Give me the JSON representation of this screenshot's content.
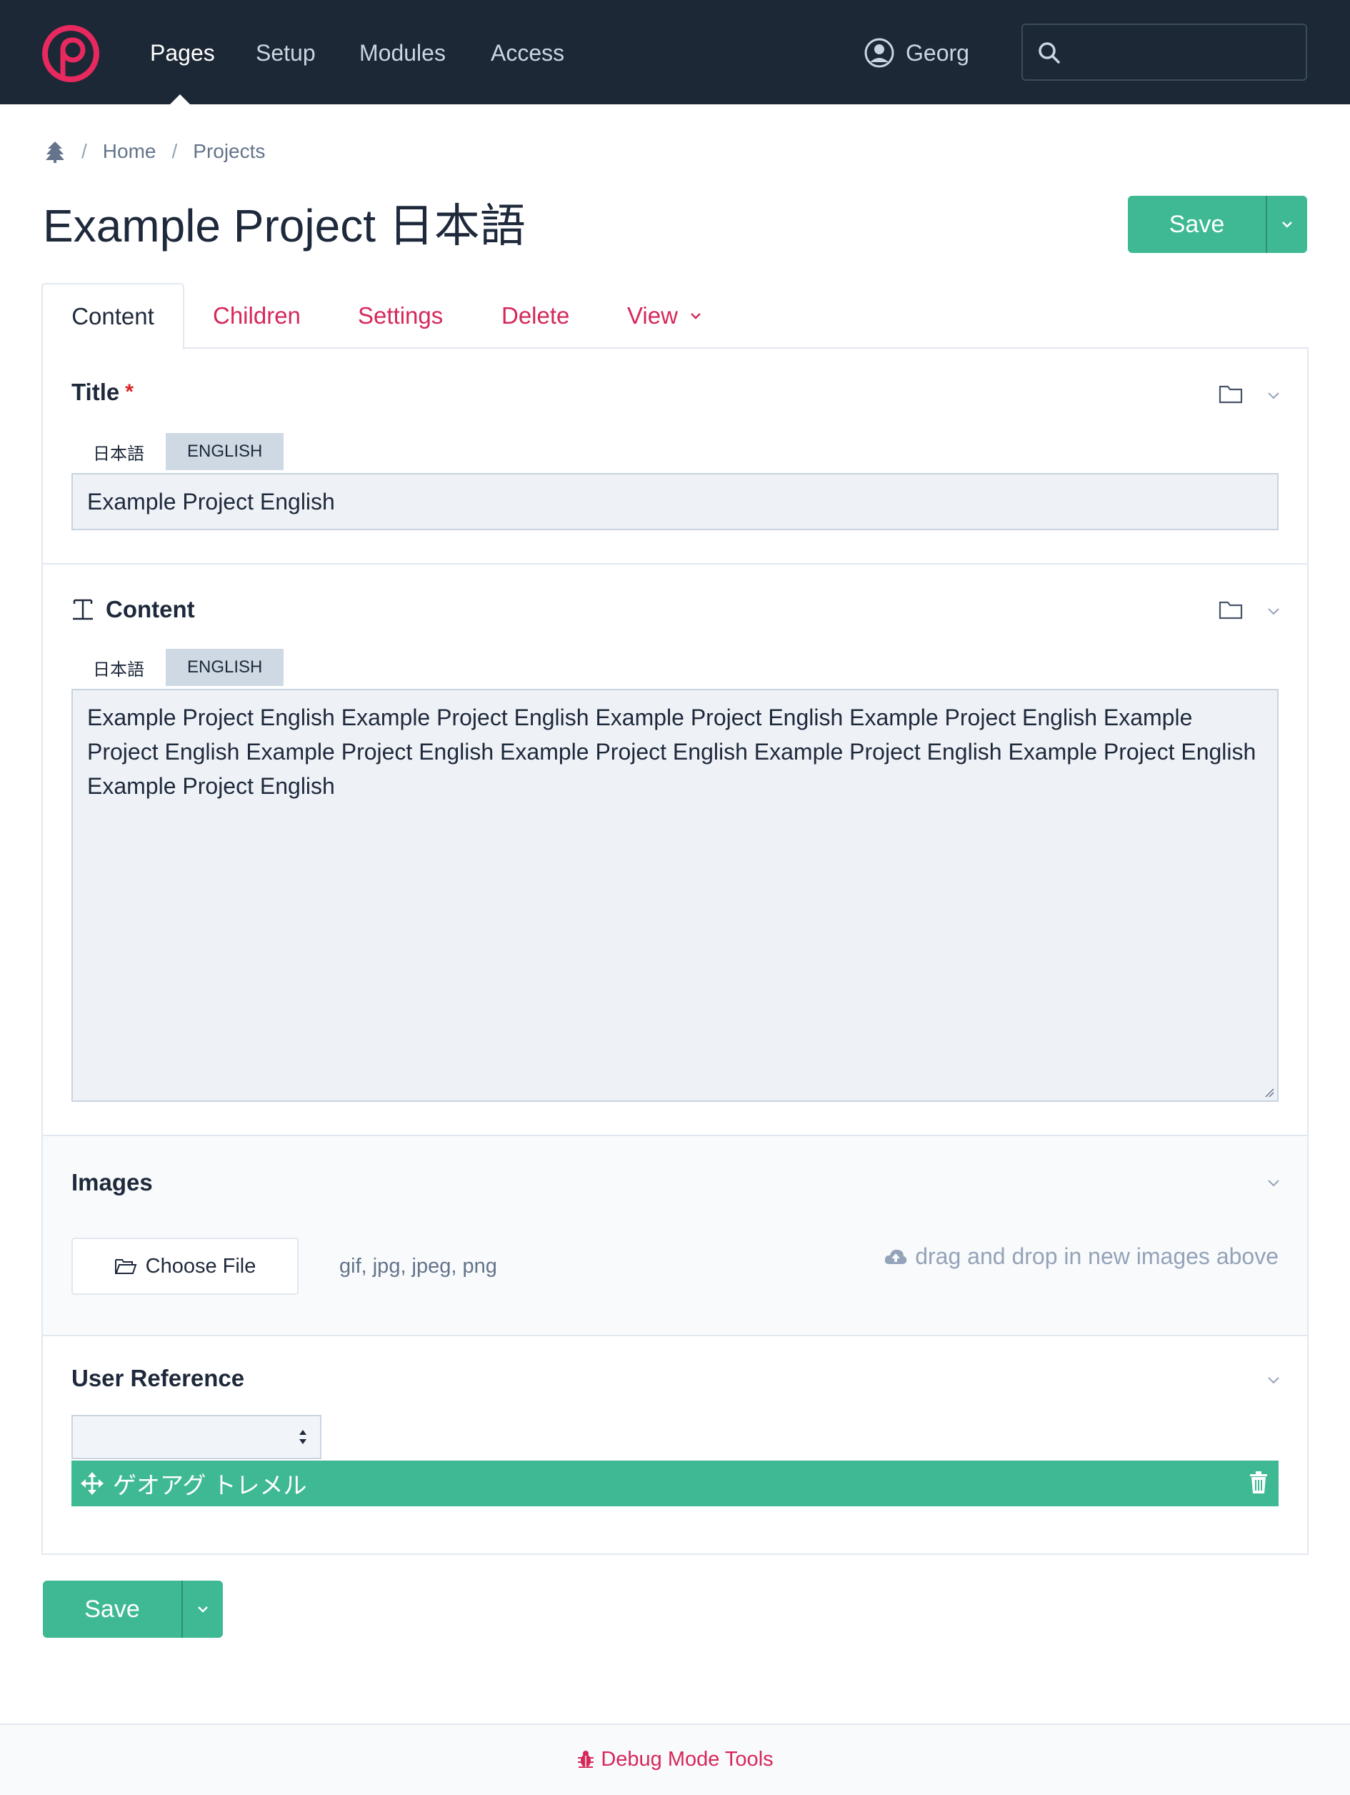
{
  "nav": {
    "items": [
      {
        "label": "Pages",
        "active": true
      },
      {
        "label": "Setup"
      },
      {
        "label": "Modules"
      },
      {
        "label": "Access"
      }
    ],
    "user_name": "Georg",
    "search_placeholder": ""
  },
  "breadcrumb": {
    "items": [
      "Home",
      "Projects"
    ]
  },
  "page": {
    "title": "Example Project 日本語",
    "save_label": "Save"
  },
  "tabs": [
    {
      "label": "Content",
      "active": true
    },
    {
      "label": "Children"
    },
    {
      "label": "Settings"
    },
    {
      "label": "Delete"
    },
    {
      "label": "View"
    }
  ],
  "fields": {
    "title": {
      "label": "Title",
      "required_mark": "*",
      "languages": [
        "日本語",
        "ENGLISH"
      ],
      "active_language": "ENGLISH",
      "value": "Example Project English"
    },
    "content": {
      "label": "Content",
      "languages": [
        "日本語",
        "ENGLISH"
      ],
      "active_language": "ENGLISH",
      "value": "Example Project English Example Project English Example Project English Example Project English Example Project English Example Project English Example Project English Example Project English Example Project English Example Project English"
    },
    "images": {
      "label": "Images",
      "choose_label": "Choose File",
      "file_types": "gif, jpg, jpeg, png",
      "dropzone_text": "drag and drop in new images above"
    },
    "user_reference": {
      "label": "User Reference",
      "select_value": "",
      "selected_item": "ゲオアグ トレメル"
    }
  },
  "bottom_save_label": "Save",
  "footer": {
    "debug_label": "Debug Mode Tools"
  },
  "colors": {
    "nav_bg": "#1c2836",
    "accent": "#d6285a",
    "save_green": "#3fb994"
  }
}
